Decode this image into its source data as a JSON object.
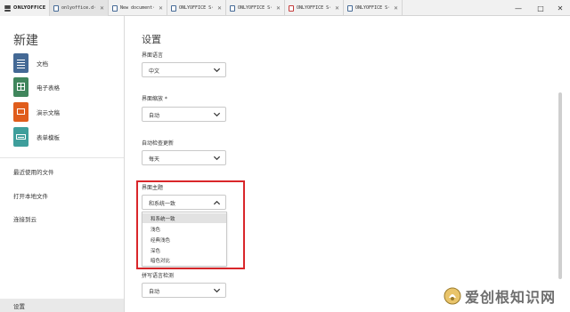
{
  "app": {
    "name": "ONLYOFFICE"
  },
  "tabs": [
    {
      "label": "onlyoffice.d···",
      "icon": "document-icon",
      "color": "#446995"
    },
    {
      "label": "New document···",
      "icon": "document-icon",
      "color": "#446995"
    },
    {
      "label": "ONLYOFFICE S···",
      "icon": "document-icon",
      "color": "#446995"
    },
    {
      "label": "ONLYOFFICE S···",
      "icon": "document-icon",
      "color": "#446995"
    },
    {
      "label": "ONLYOFFICE S···",
      "icon": "pdf-icon",
      "color": "#c43a3a"
    },
    {
      "label": "ONLYOFFICE S···",
      "icon": "document-icon",
      "color": "#446995"
    }
  ],
  "window_controls": {
    "minimize": "—",
    "maximize": "□",
    "close": "✕"
  },
  "sidebar": {
    "new_title": "新建",
    "create_items": [
      {
        "label": "文档",
        "icon": "document-icon",
        "color": "#446995"
      },
      {
        "label": "电子表格",
        "icon": "spreadsheet-icon",
        "color": "#40865c"
      },
      {
        "label": "演示文稿",
        "icon": "presentation-icon",
        "color": "#e05d1c"
      },
      {
        "label": "表单模板",
        "icon": "form-template-icon",
        "color": "#3e9e9b"
      }
    ],
    "nav": {
      "recent": "最近使用的文件",
      "open_local": "打开本地文件",
      "connect_cloud": "连接到云",
      "settings": "设置"
    }
  },
  "settings": {
    "title": "设置",
    "interface_language": {
      "label": "界面语言",
      "value": "中文"
    },
    "interface_scale": {
      "label": "界面缩放 *",
      "value": "自动"
    },
    "auto_check_updates": {
      "label": "自动检查更新",
      "value": "每天"
    },
    "interface_theme": {
      "label": "界面主题",
      "value": "和系统一致",
      "options": [
        "和系统一致",
        "浅色",
        "经典浅色",
        "深色",
        "暗色对比"
      ],
      "highlight_color": "#d9262a"
    },
    "spell_check": {
      "label": "拼写语言检测",
      "value": "自动"
    }
  },
  "watermark": {
    "text": "爱创根知识网"
  }
}
